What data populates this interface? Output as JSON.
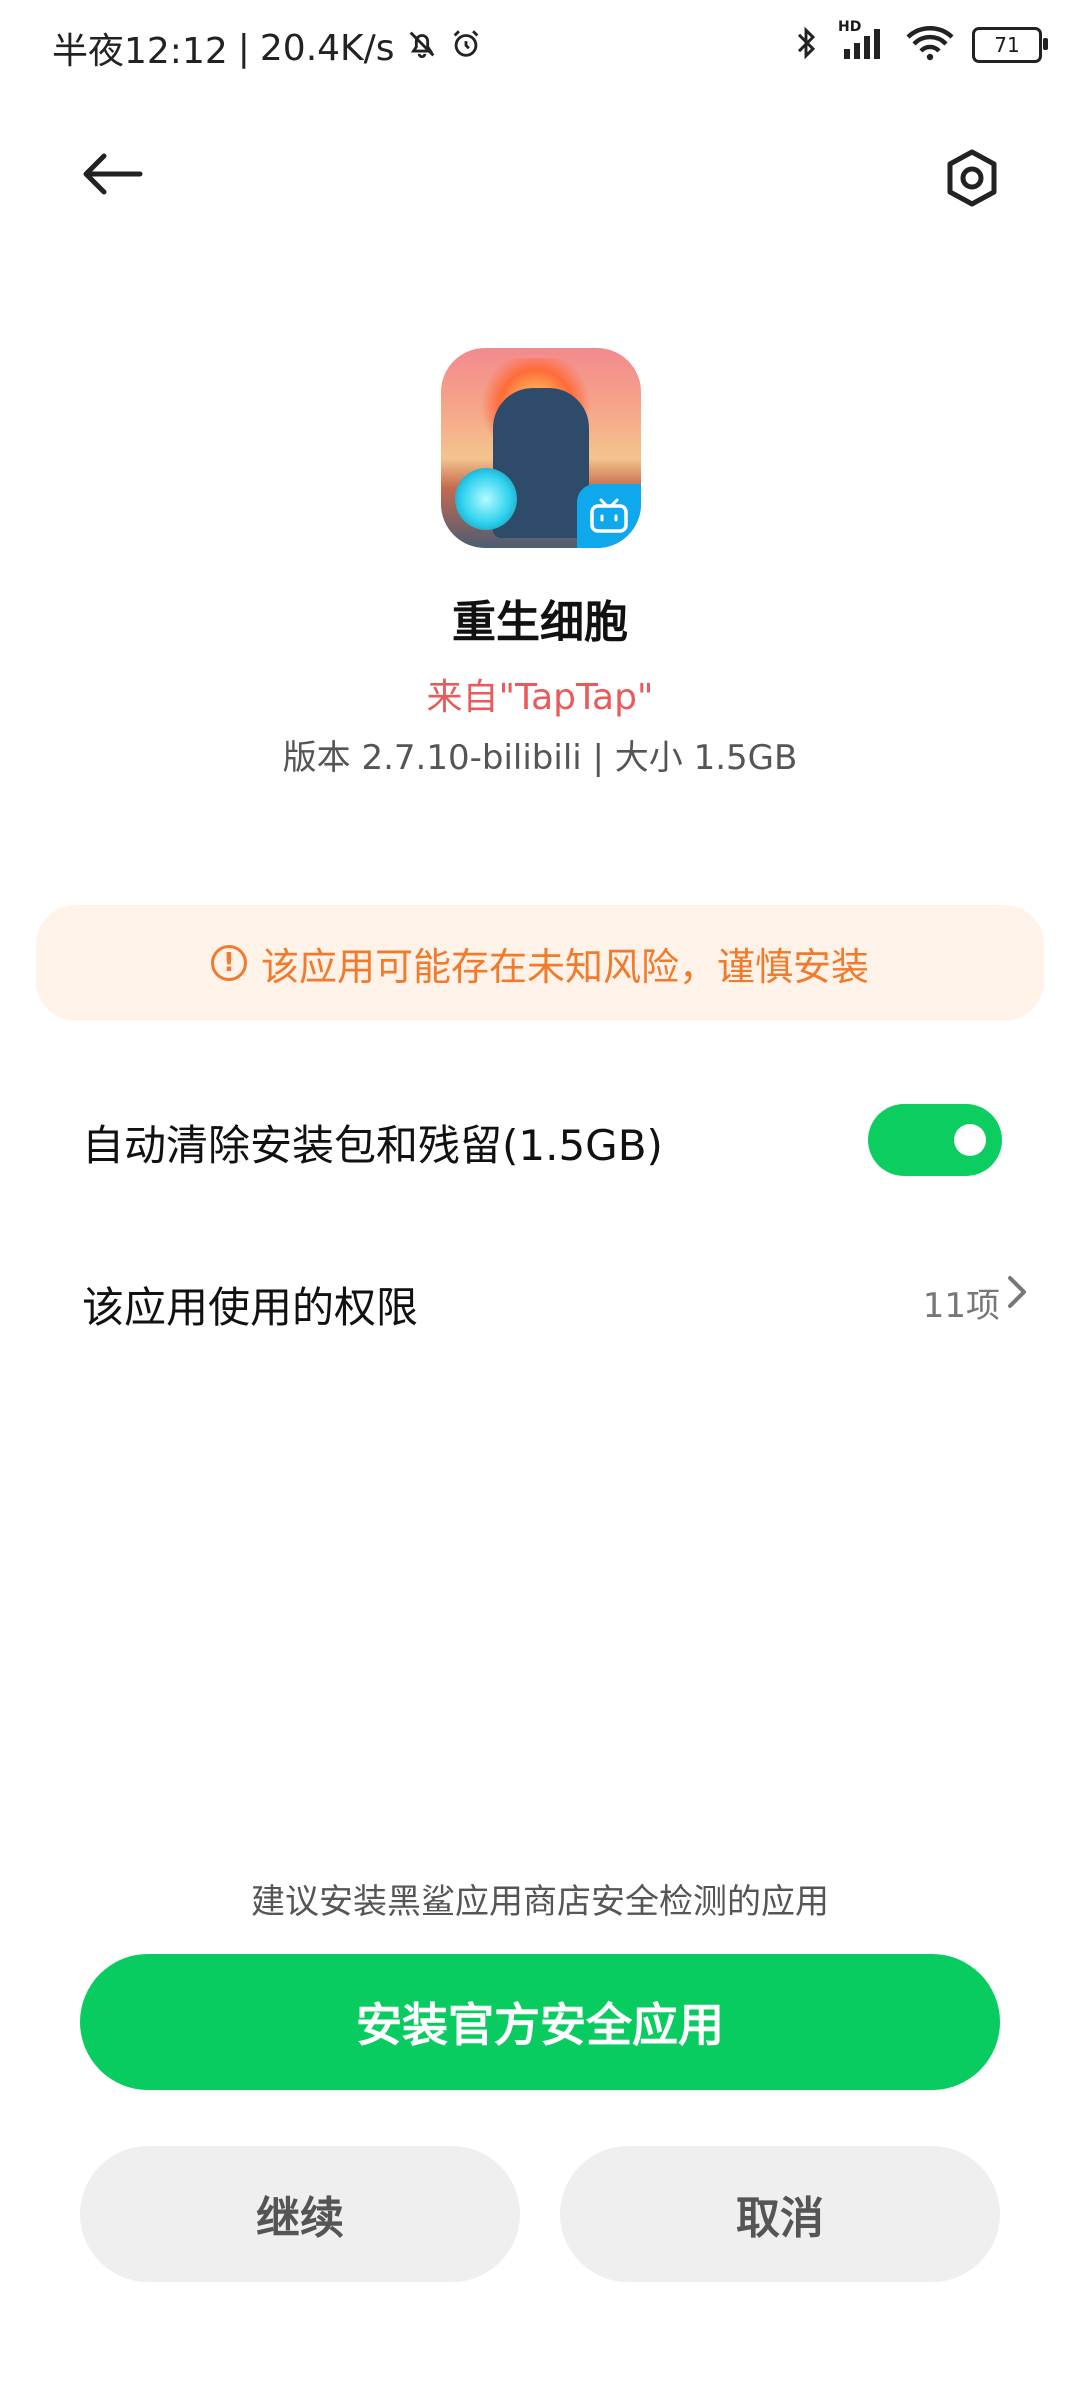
{
  "status_bar": {
    "time": "半夜12:12",
    "separator": "|",
    "net_speed": "20.4K/s",
    "network_label": "HD",
    "battery_level": "71",
    "icons": [
      "bell-off-icon",
      "alarm-icon",
      "bluetooth-icon",
      "signal-icon",
      "wifi-icon",
      "battery-icon"
    ]
  },
  "header": {
    "back_icon": "arrow-left-icon",
    "settings_icon": "hexagon-settings-icon"
  },
  "app": {
    "name": "重生细胞",
    "source": "来自\"TapTap\"",
    "meta": "版本 2.7.10-bilibili | 大小 1.5GB"
  },
  "warning": {
    "text": "该应用可能存在未知风险，谨慎安装",
    "icon_glyph": "!"
  },
  "settings": {
    "auto_clean_label": "自动清除安装包和残留(1.5GB)",
    "auto_clean_on": true,
    "permissions_label": "该应用使用的权限",
    "permissions_count": "11项"
  },
  "hint": "建议安装黑鲨应用商店安全检测的应用",
  "buttons": {
    "install_official": "安装官方安全应用",
    "continue": "继续",
    "cancel": "取消"
  },
  "colors": {
    "accent_green": "#08cc5f",
    "warning_orange": "#f07b2c",
    "source_red": "#e95b5b"
  }
}
